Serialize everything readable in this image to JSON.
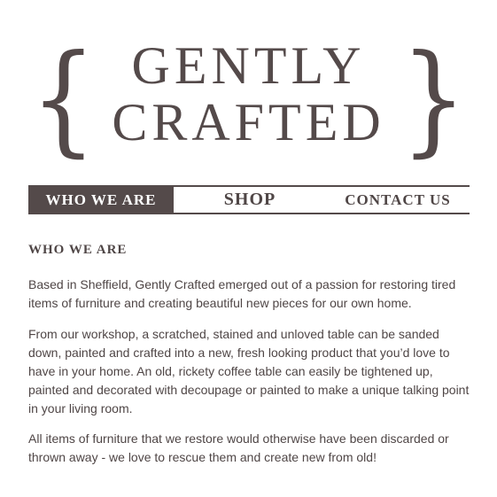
{
  "logo": {
    "line1": "GENTLY",
    "line2": "CRAFTED",
    "brace_left": "{",
    "brace_right": "}"
  },
  "nav": {
    "items": [
      {
        "label": "WHO WE ARE",
        "active": true
      },
      {
        "label": "SHOP",
        "active": false
      },
      {
        "label": "CONTACT US",
        "active": false
      }
    ]
  },
  "main": {
    "heading": "WHO WE ARE",
    "paragraphs": [
      "Based in Sheffield, Gently Crafted emerged out of a passion for restoring tired items of furniture and creating beautiful new pieces for our own home.",
      "From our workshop, a scratched, stained and unloved table can be sanded down, painted and crafted into a new, fresh looking product that you’d love to have in your home. An old, rickety coffee table can easily be tightened up, painted and decorated with decoupage or painted to make a unique talking point in your living room.",
      "All items of furniture that we restore would otherwise have been discarded or thrown away - we love to rescue them and create new from old!"
    ]
  },
  "colors": {
    "brand": "#544a4a",
    "text": "#4f4646",
    "background": "#ffffff"
  }
}
